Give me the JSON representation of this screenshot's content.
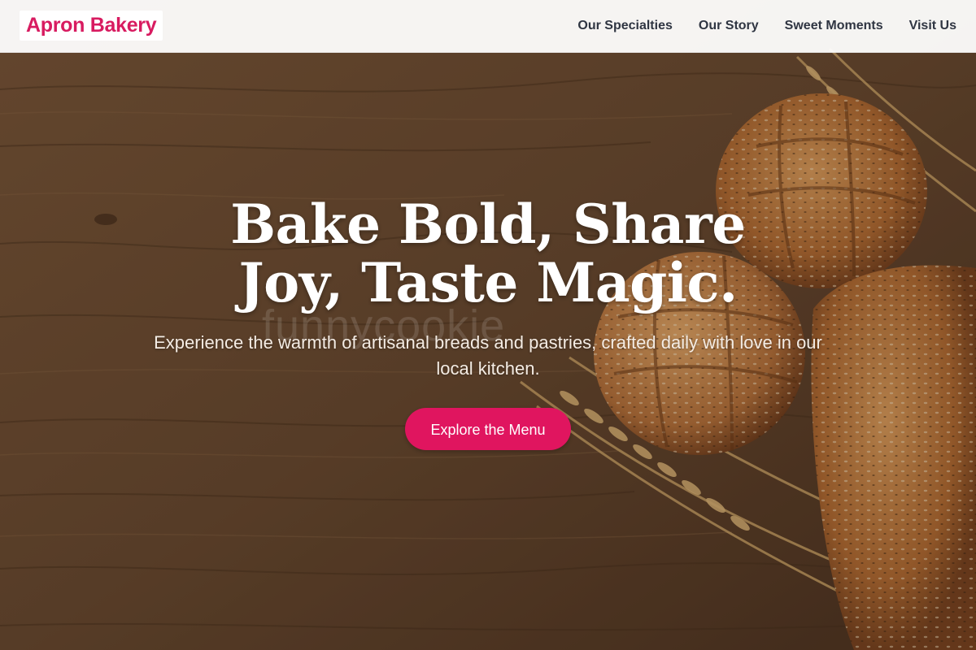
{
  "brand": {
    "name": "Apron Bakery",
    "accent_color": "#d81b60"
  },
  "nav": {
    "items": [
      {
        "label": "Our Specialties"
      },
      {
        "label": "Our Story"
      },
      {
        "label": "Sweet Moments"
      },
      {
        "label": "Visit Us"
      }
    ]
  },
  "hero": {
    "title": "Bake Bold, Share Joy, Taste Magic.",
    "subtitle": "Experience the warmth of artisanal breads and pastries, crafted daily with love in our local kitchen.",
    "cta_label": "Explore the Menu",
    "cta_color": "#e0155f",
    "background_image": "wooden table with seeded bread loaves and wheat stalks",
    "watermark": "funnycookie"
  }
}
